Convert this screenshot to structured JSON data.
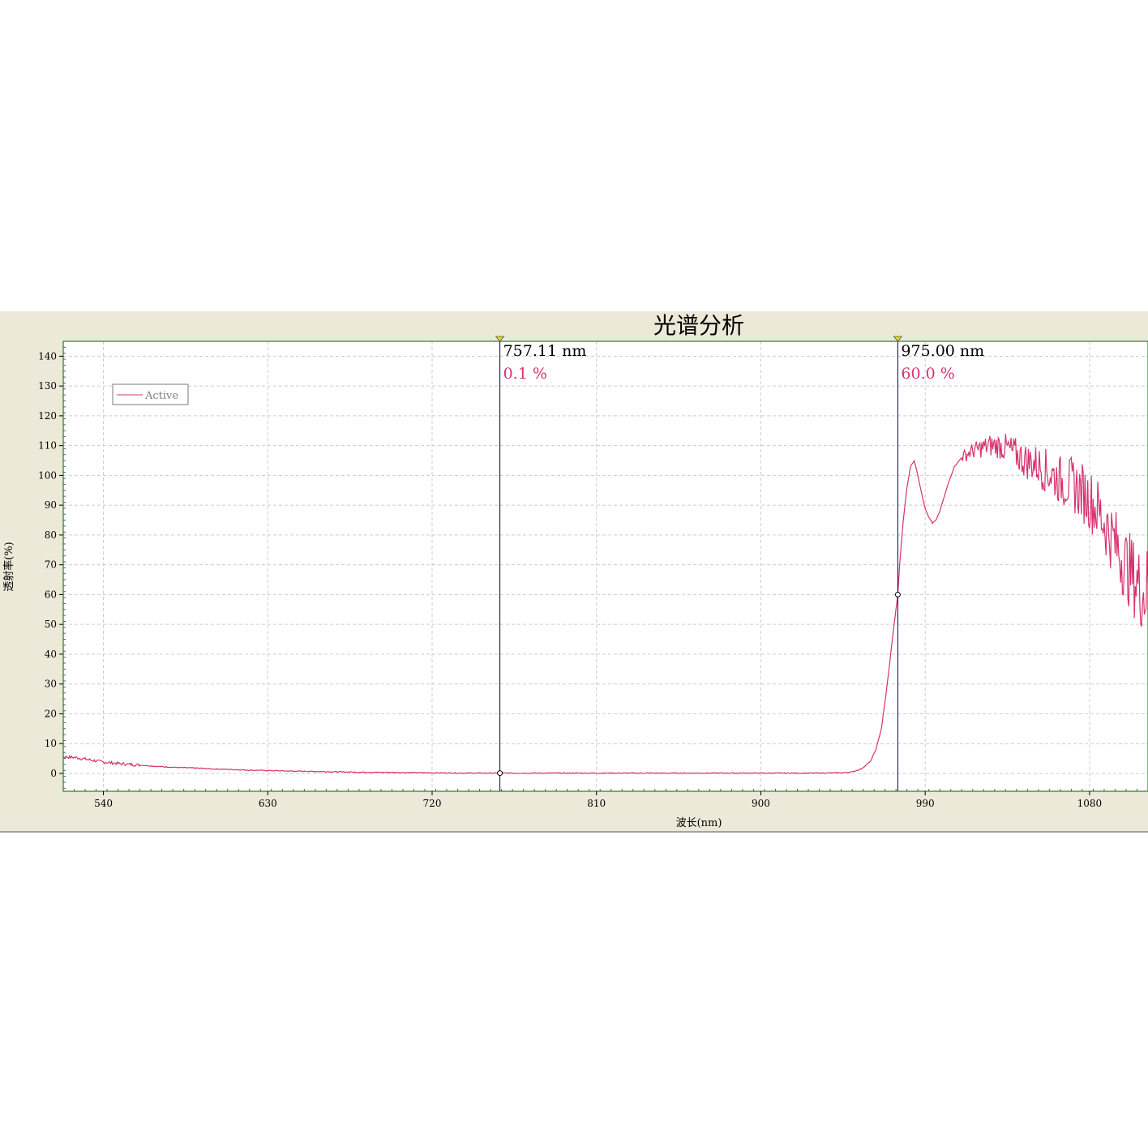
{
  "chart_data": {
    "type": "line",
    "title": "光谱分析",
    "xlabel": "波长(nm)",
    "ylabel": "透射率(%)",
    "xlim": [
      518,
      1112
    ],
    "ylim": [
      -6,
      145
    ],
    "x_ticks": [
      540,
      630,
      720,
      810,
      900,
      990,
      1080
    ],
    "y_ticks": [
      0,
      10,
      20,
      30,
      40,
      50,
      60,
      70,
      80,
      90,
      100,
      110,
      120,
      130,
      140
    ],
    "grid": true,
    "legend": {
      "position": "top-left",
      "entries": [
        "Active"
      ]
    },
    "series": [
      {
        "name": "Active",
        "color": "#d6336c",
        "points": [
          [
            500,
            7.8
          ],
          [
            503,
            7.1
          ],
          [
            505,
            6.9
          ],
          [
            508,
            6.6
          ],
          [
            510,
            6.3
          ],
          [
            512,
            6.0
          ],
          [
            515,
            5.7
          ],
          [
            520,
            5.5
          ],
          [
            525,
            5.3
          ],
          [
            530,
            4.8
          ],
          [
            535,
            4.3
          ],
          [
            540,
            3.8
          ],
          [
            545,
            3.5
          ],
          [
            550,
            3.2
          ],
          [
            560,
            2.8
          ],
          [
            570,
            2.3
          ],
          [
            580,
            2.0
          ],
          [
            590,
            1.8
          ],
          [
            600,
            1.5
          ],
          [
            620,
            1.1
          ],
          [
            640,
            0.8
          ],
          [
            660,
            0.6
          ],
          [
            680,
            0.4
          ],
          [
            700,
            0.3
          ],
          [
            720,
            0.2
          ],
          [
            740,
            0.1
          ],
          [
            757.11,
            0.1
          ],
          [
            780,
            0.1
          ],
          [
            810,
            0.1
          ],
          [
            840,
            0.1
          ],
          [
            870,
            0.1
          ],
          [
            900,
            0.1
          ],
          [
            930,
            0.1
          ],
          [
            945,
            0.2
          ],
          [
            950,
            0.5
          ],
          [
            955,
            1.5
          ],
          [
            960,
            4
          ],
          [
            963,
            8
          ],
          [
            966,
            15
          ],
          [
            968,
            24
          ],
          [
            970,
            34
          ],
          [
            972,
            45
          ],
          [
            974,
            55
          ],
          [
            975,
            60
          ],
          [
            976,
            70
          ],
          [
            978,
            85
          ],
          [
            980,
            96
          ],
          [
            982,
            103
          ],
          [
            984,
            105
          ],
          [
            986,
            100
          ],
          [
            988,
            94
          ],
          [
            990,
            89
          ],
          [
            992,
            86
          ],
          [
            994,
            84
          ],
          [
            996,
            85
          ],
          [
            998,
            88
          ],
          [
            1000,
            92
          ],
          [
            1003,
            98
          ],
          [
            1006,
            103
          ],
          [
            1010,
            106
          ],
          [
            1015,
            108
          ],
          [
            1020,
            109
          ],
          [
            1025,
            110
          ],
          [
            1030,
            110
          ],
          [
            1035,
            109
          ],
          [
            1040,
            107
          ],
          [
            1045,
            105
          ],
          [
            1050,
            104
          ],
          [
            1055,
            102
          ],
          [
            1060,
            100
          ],
          [
            1065,
            98
          ],
          [
            1070,
            97
          ],
          [
            1075,
            95
          ],
          [
            1080,
            92
          ],
          [
            1085,
            88
          ],
          [
            1090,
            82
          ],
          [
            1095,
            76
          ],
          [
            1100,
            70
          ],
          [
            1105,
            65
          ],
          [
            1110,
            60
          ],
          [
            1112,
            64
          ]
        ]
      }
    ],
    "cursors": [
      {
        "x": 757.11,
        "y": 0.1,
        "x_label": "757.11 nm",
        "y_label": "0.1 %"
      },
      {
        "x": 975.0,
        "y": 60.0,
        "x_label": "975.00 nm",
        "y_label": "60.0 %"
      }
    ]
  },
  "colors": {
    "panel_bg": "#ece9d8",
    "plot_bg": "#ffffff",
    "plot_border": "#2f7a2f",
    "grid": "#cccccc",
    "series": "#d6336c",
    "cursor_line": "#000055",
    "cursor_marker": "#e8d800"
  }
}
